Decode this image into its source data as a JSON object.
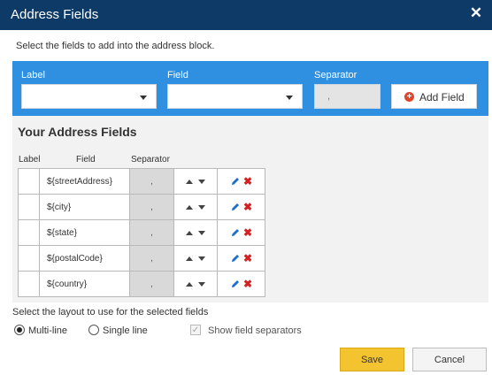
{
  "dialog": {
    "title": "Address Fields",
    "close_glyph": "✕",
    "intro": "Select the fields to add into the address block."
  },
  "editor": {
    "label_heading": "Label",
    "field_heading": "Field",
    "separator_heading": "Separator",
    "label_value": "",
    "field_value": "",
    "separator_value": ",",
    "add_button_label": "Add Field",
    "add_icon": "plus-circle-icon"
  },
  "address_fields": {
    "heading": "Your Address Fields",
    "columns": [
      "Label",
      "Field",
      "Separator"
    ],
    "rows": [
      {
        "label": "",
        "field": "${streetAddress}",
        "separator": ","
      },
      {
        "label": "",
        "field": "${city}",
        "separator": ","
      },
      {
        "label": "",
        "field": "${state}",
        "separator": ","
      },
      {
        "label": "",
        "field": "${postalCode}",
        "separator": ","
      },
      {
        "label": "",
        "field": "${country}",
        "separator": ","
      }
    ]
  },
  "layout": {
    "prompt": "Select the layout to use for the selected fields",
    "multi_line_label": "Multi-line",
    "single_line_label": "Single line",
    "selected": "multi-line",
    "show_separators_label": "Show field separators",
    "show_separators_checked": true,
    "check_glyph": "✓"
  },
  "buttons": {
    "save_label": "Save",
    "cancel_label": "Cancel"
  },
  "colors": {
    "title_bar": "#0d3a66",
    "editor_bar": "#2f8fe0",
    "save_button": "#f4c430",
    "delete_icon": "#d42020",
    "edit_icon": "#1f6fc7"
  }
}
